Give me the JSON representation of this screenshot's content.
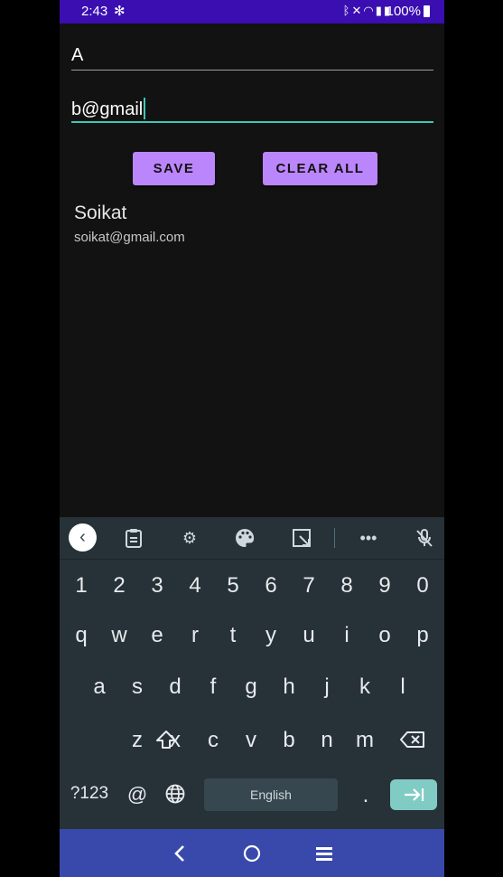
{
  "status_bar": {
    "time": "2:43",
    "notification_icon": "fan-icon",
    "system_icons": [
      "bluetooth-icon",
      "mute-icon",
      "wifi-icon",
      "signal-icon",
      "signal-icon"
    ],
    "battery_text": "100%"
  },
  "form": {
    "name_value": "A",
    "email_value": "b@gmail",
    "save_label": "SAVE",
    "clear_label": "CLEAR ALL"
  },
  "list": {
    "items": [
      {
        "name": "Soikat",
        "email": "soikat@gmail.com"
      }
    ]
  },
  "keyboard": {
    "toolbar": [
      "back-icon",
      "clipboard-icon",
      "gear-icon",
      "palette-icon",
      "resize-icon",
      "more-icon",
      "mic-off-icon"
    ],
    "row_numbers": [
      "1",
      "2",
      "3",
      "4",
      "5",
      "6",
      "7",
      "8",
      "9",
      "0"
    ],
    "row_top": [
      "q",
      "w",
      "e",
      "r",
      "t",
      "y",
      "u",
      "i",
      "o",
      "p"
    ],
    "row_home": [
      "a",
      "s",
      "d",
      "f",
      "g",
      "h",
      "j",
      "k",
      "l"
    ],
    "row_bottom": [
      "z",
      "x",
      "c",
      "v",
      "b",
      "n",
      "m"
    ],
    "symbols_label": "?123",
    "at_label": "@",
    "space_label": "English",
    "period_label": "."
  },
  "colors": {
    "status_bar": "#3a0eb0",
    "background": "#121212",
    "accent_button": "#bb86fc",
    "focus_line": "#3ec7b5",
    "keyboard_bg": "#263238",
    "enter_key": "#80cbc4",
    "nav_bar": "#3949ab"
  }
}
